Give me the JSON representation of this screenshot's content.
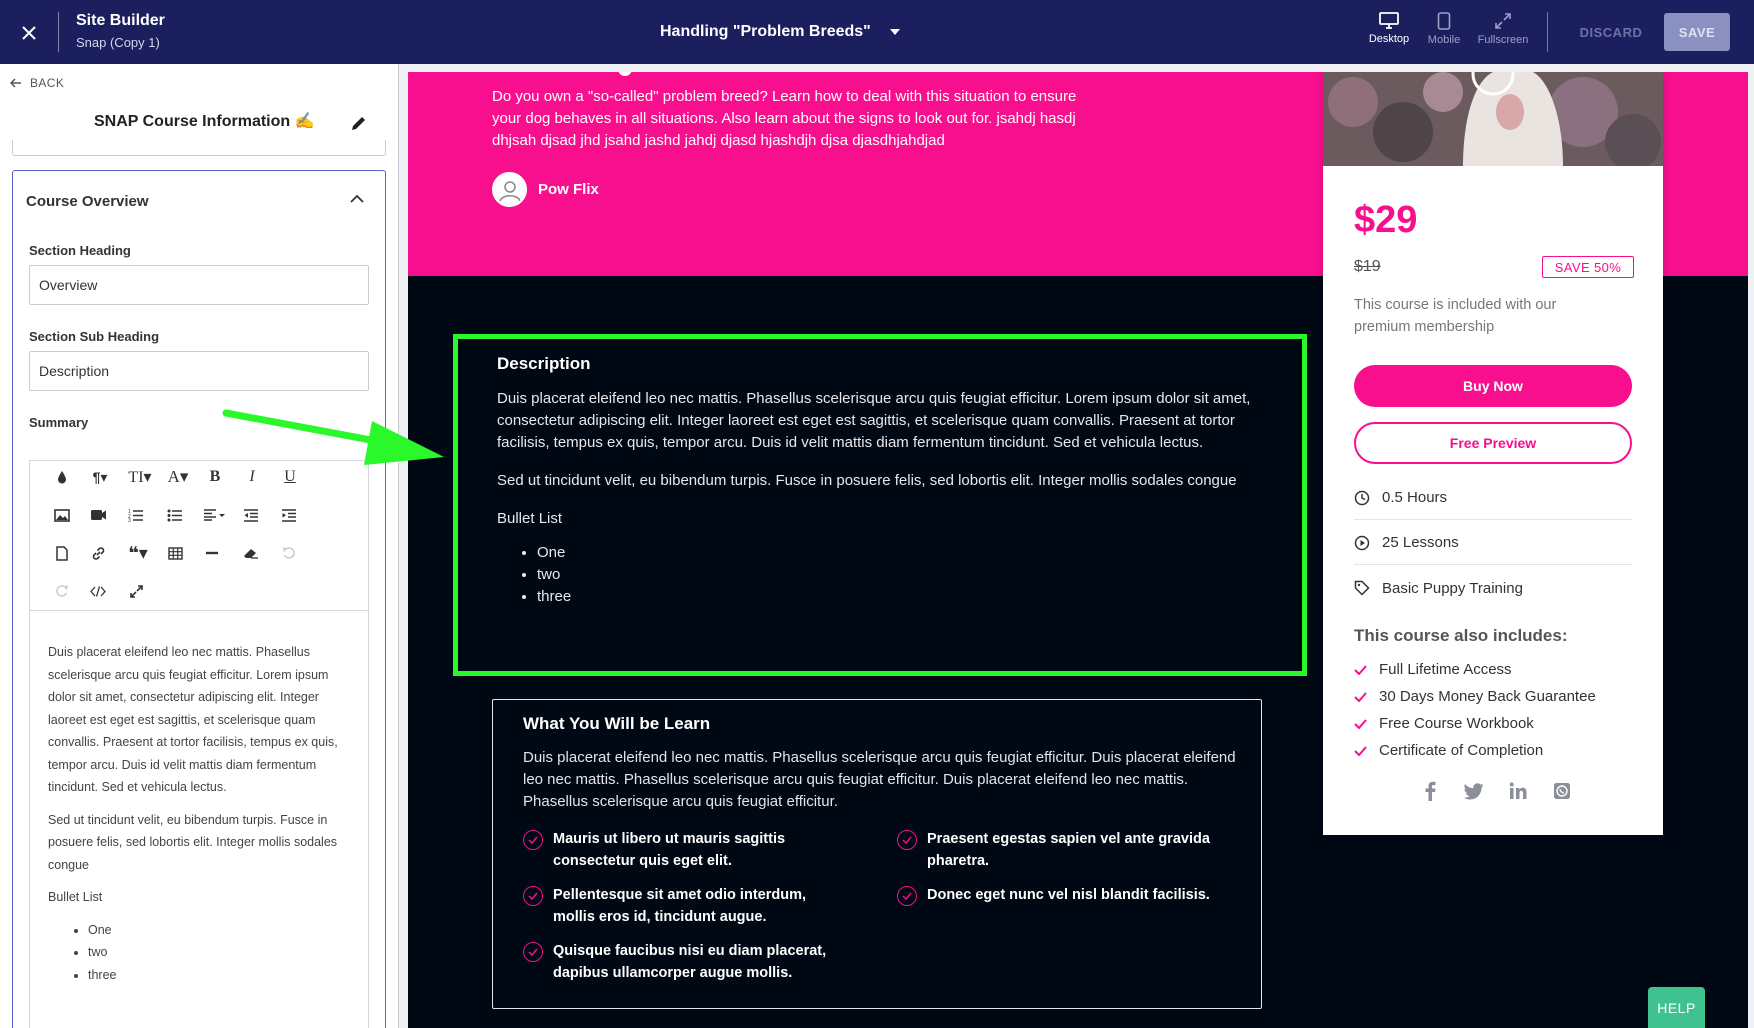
{
  "topbar": {
    "title": "Site Builder",
    "subtitle": "Snap (Copy 1)",
    "page_selector": "Handling \"Problem Breeds\"",
    "devices": [
      {
        "label": "Desktop",
        "active": true
      },
      {
        "label": "Mobile",
        "active": false
      },
      {
        "label": "Fullscreen",
        "active": false
      }
    ],
    "discard_label": "DISCARD",
    "save_label": "SAVE"
  },
  "left_panel": {
    "back_label": "BACK",
    "header": "SNAP Course Information ✍️",
    "card_title": "Course Overview",
    "section_heading_label": "Section Heading",
    "section_heading_value": "Overview",
    "section_sub_heading_label": "Section Sub Heading",
    "section_sub_heading_value": "Description",
    "summary_label": "Summary",
    "toolbar_icons": [
      "drop-icon",
      "paragraph-icon",
      "text-size-icon",
      "font-color-icon",
      "bold-icon",
      "italic-icon",
      "underline-icon",
      "image-icon",
      "video-icon",
      "ordered-list-icon",
      "unordered-list-icon",
      "align-icon",
      "outdent-icon",
      "indent-icon",
      "file-icon",
      "link-icon",
      "quote-icon",
      "table-icon",
      "horizontal-rule-icon",
      "eraser-icon",
      "undo-icon",
      "redo-icon",
      "code-icon",
      "expand-icon"
    ],
    "editor": {
      "p1": "Duis placerat eleifend leo nec mattis. Phasellus scelerisque arcu quis feugiat efficitur. Lorem ipsum dolor sit amet, consectetur adipiscing elit. Integer laoreet est eget est sagittis, et scelerisque quam convallis. Praesent at tortor facilisis, tempus ex quis, tempor arcu. Duis id velit mattis diam fermentum tincidunt. Sed et vehicula lectus.",
      "p2": "Sed ut tincidunt velit, eu bibendum turpis. Fusce in posuere felis, sed lobortis elit. Integer mollis sodales congue",
      "p3": "Bullet List",
      "bullets": [
        "One",
        "two",
        "three"
      ]
    }
  },
  "canvas": {
    "hero": {
      "description": "Do you own a \"so-called\" problem breed? Learn how to deal with this situation to ensure your dog behaves in all situations. Also learn about the signs to look out for. jsahdj hasdj dhjsah djsad jhd jsahd jashd jahdj djasd hjashdjh djsa djasdhjahdjad",
      "author": "Pow Flix"
    },
    "description": {
      "title": "Description",
      "p1": "Duis placerat eleifend leo nec mattis. Phasellus scelerisque arcu quis feugiat efficitur. Lorem ipsum dolor sit amet, consectetur adipiscing elit. Integer laoreet est eget est sagittis, et scelerisque quam convallis. Praesent at tortor facilisis, tempus ex quis, tempor arcu. Duis id velit mattis diam fermentum tincidunt. Sed et vehicula lectus.",
      "p2": "Sed ut tincidunt velit, eu bibendum turpis. Fusce in posuere felis, sed lobortis elit. Integer mollis sodales congue",
      "p3": "Bullet List",
      "bullets": [
        "One",
        "two",
        "three"
      ]
    },
    "learn": {
      "title": "What You Will be Learn",
      "description": "Duis placerat eleifend leo nec mattis. Phasellus scelerisque arcu quis feugiat efficitur. Duis placerat eleifend leo nec mattis. Phasellus scelerisque arcu quis feugiat efficitur. Duis placerat eleifend leo nec mattis. Phasellus scelerisque arcu quis feugiat efficitur.",
      "items": [
        "Mauris ut libero ut mauris sagittis consectetur quis eget elit.",
        "Praesent egestas sapien vel ante gravida pharetra.",
        "Pellentesque sit amet odio interdum, mollis eros id, tincidunt augue.",
        "Donec eget nunc vel nisl blandit facilisis.",
        "Quisque faucibus nisi eu diam placerat, dapibus ullamcorper augue mollis."
      ]
    },
    "pricing": {
      "price": "$29",
      "old_price": "$19",
      "save_badge": "SAVE 50%",
      "included_text": "This course is included with our premium membership",
      "buy_label": "Buy Now",
      "preview_label": "Free Preview",
      "meta": [
        {
          "icon": "clock-icon",
          "text": "0.5 Hours"
        },
        {
          "icon": "play-circle-icon",
          "text": "25 Lessons"
        },
        {
          "icon": "tag-icon",
          "text": "Basic Puppy Training"
        }
      ],
      "also_title": "This course also includes:",
      "also_items": [
        "Full Lifetime Access",
        "30 Days Money Back Guarantee",
        "Free Course Workbook",
        "Certificate of Completion"
      ],
      "socials": [
        "facebook-icon",
        "twitter-icon",
        "linkedin-icon",
        "whatsapp-icon"
      ]
    }
  },
  "help_label": "HELP",
  "colors": {
    "topbar": "#1b1f5e",
    "brand_pink": "#f70f8d",
    "canvas_dark": "#000814",
    "highlight_green": "#2af82a",
    "help_green": "#3fc28f"
  }
}
